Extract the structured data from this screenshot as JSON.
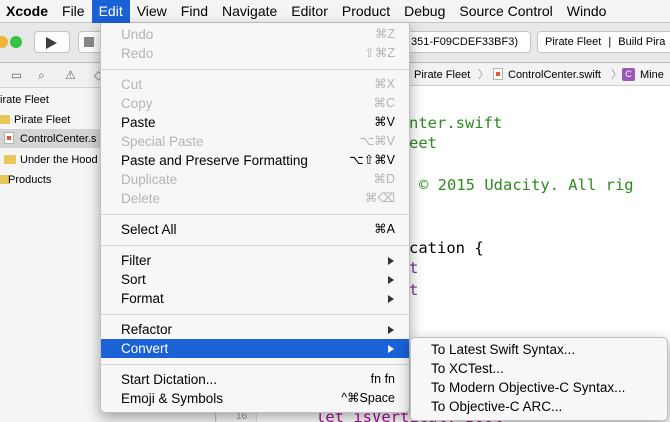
{
  "menubar": {
    "items": [
      "Xcode",
      "File",
      "Edit",
      "View",
      "Find",
      "Navigate",
      "Editor",
      "Product",
      "Debug",
      "Source Control",
      "Windo"
    ]
  },
  "toolbar": {
    "scheme_text": "351-F09CDEF33BF3)",
    "activity_project": "Pirate Fleet",
    "activity_separator": "|",
    "activity_status": "Build Pira"
  },
  "navigator": {
    "items": [
      {
        "label": "irate Fleet"
      },
      {
        "label": "Pirate Fleet"
      },
      {
        "label": "ControlCenter.s"
      },
      {
        "label": "Under the Hood"
      },
      {
        "label": "Products"
      }
    ]
  },
  "jumpbar": {
    "crumbs": [
      "Pirate Fleet",
      "ControlCenter.swift",
      "Mine"
    ]
  },
  "editor": {
    "lines": [
      "nter.swift",
      "eet",
      "© 2015 Udacity. All rig",
      "cation {",
      "t",
      "t"
    ],
    "bottom_line": {
      "number": "16",
      "text": "let isVertical: Bool"
    }
  },
  "edit_menu": {
    "items": [
      {
        "label": "Undo",
        "shortcut": "⌘Z"
      },
      {
        "label": "Redo",
        "shortcut": "⇧⌘Z"
      },
      {
        "label": "Cut",
        "shortcut": "⌘X"
      },
      {
        "label": "Copy",
        "shortcut": "⌘C"
      },
      {
        "label": "Paste",
        "shortcut": "⌘V"
      },
      {
        "label": "Special Paste",
        "shortcut": "⌥⌘V"
      },
      {
        "label": "Paste and Preserve Formatting",
        "shortcut": "⌥⇧⌘V"
      },
      {
        "label": "Duplicate",
        "shortcut": "⌘D"
      },
      {
        "label": "Delete",
        "shortcut": "⌘⌫"
      },
      {
        "label": "Select All",
        "shortcut": "⌘A"
      },
      {
        "label": "Filter"
      },
      {
        "label": "Sort"
      },
      {
        "label": "Format"
      },
      {
        "label": "Refactor"
      },
      {
        "label": "Convert"
      },
      {
        "label": "Start Dictation...",
        "shortcut": "fn fn"
      },
      {
        "label": "Emoji & Symbols",
        "shortcut": "^⌘Space"
      }
    ]
  },
  "convert_submenu": {
    "items": [
      "To Latest Swift Syntax...",
      "To XCTest...",
      "To Modern Objective-C Syntax...",
      "To Objective-C ARC..."
    ]
  },
  "colors": {
    "accent": "#1a62d6",
    "code_green": "#2f8a1f",
    "code_purple": "#7d2fa3",
    "keyword_pink": "#aa0d91"
  }
}
